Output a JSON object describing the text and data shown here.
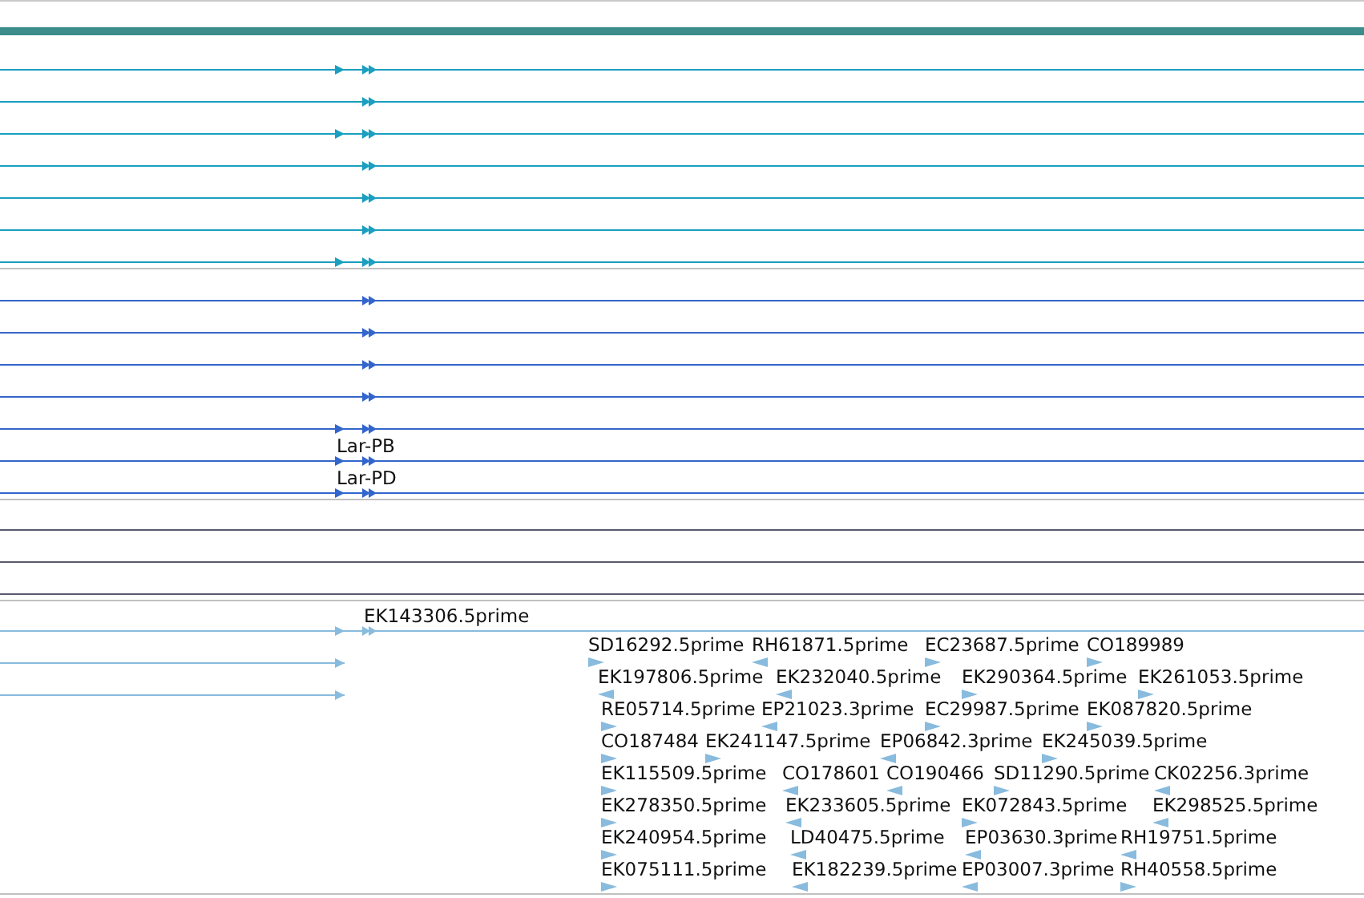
{
  "tracks": [
    {
      "color": "#1a9fc0",
      "rows": [
        {
          "upstream_arrow": true,
          "double_arrow": true,
          "truncated": false
        },
        {
          "upstream_arrow": false,
          "double_arrow": true,
          "truncated": false
        },
        {
          "upstream_arrow": true,
          "double_arrow": true,
          "truncated": false
        },
        {
          "upstream_arrow": false,
          "double_arrow": true,
          "truncated": false
        },
        {
          "upstream_arrow": false,
          "double_arrow": true,
          "truncated": false
        },
        {
          "upstream_arrow": false,
          "double_arrow": true,
          "truncated": false
        },
        {
          "upstream_arrow": true,
          "double_arrow": true,
          "truncated": false
        }
      ]
    },
    {
      "color": "#3366cc",
      "rows": [
        {
          "upstream_arrow": false,
          "double_arrow": true,
          "truncated": false
        },
        {
          "upstream_arrow": false,
          "double_arrow": true,
          "truncated": false
        },
        {
          "upstream_arrow": false,
          "double_arrow": true,
          "truncated": false
        },
        {
          "upstream_arrow": false,
          "double_arrow": true,
          "truncated": false
        },
        {
          "upstream_arrow": true,
          "double_arrow": true,
          "truncated": false
        },
        {
          "upstream_arrow": true,
          "double_arrow": true,
          "truncated": false,
          "label": "Lar-PB"
        },
        {
          "upstream_arrow": true,
          "double_arrow": true,
          "truncated": false,
          "label": "Lar-PD"
        }
      ]
    },
    {
      "color": "#5a5a6e",
      "rows": [
        {
          "upstream_arrow": false,
          "double_arrow": false,
          "truncated": false
        },
        {
          "upstream_arrow": false,
          "double_arrow": false,
          "truncated": false
        },
        {
          "upstream_arrow": false,
          "double_arrow": false,
          "truncated": false
        }
      ]
    },
    {
      "color": "#88bbdd",
      "rows": [
        {
          "upstream_arrow": true,
          "double_arrow": true,
          "truncated": false,
          "label": "EK143306.5prime"
        },
        {
          "upstream_arrow": true,
          "double_arrow": false,
          "truncated": true
        },
        {
          "upstream_arrow": true,
          "double_arrow": false,
          "truncated": true
        }
      ],
      "reads": [
        [
          {
            "label": "SD16292.5prime",
            "reverse": false
          },
          {
            "label": "RH61871.5prime",
            "reverse": true
          },
          {
            "label": "EC23687.5prime",
            "reverse": false
          },
          {
            "label": "CO189989",
            "reverse": false
          }
        ],
        [
          {
            "label": "EK197806.5prime",
            "reverse": true
          },
          {
            "label": "EK232040.5prime",
            "reverse": true
          },
          {
            "label": "EK290364.5prime",
            "reverse": false
          },
          {
            "label": "EK261053.5prime",
            "reverse": false
          }
        ],
        [
          {
            "label": "RE05714.5prime",
            "reverse": false
          },
          {
            "label": "EP21023.3prime",
            "reverse": true
          },
          {
            "label": "EC29987.5prime",
            "reverse": false
          },
          {
            "label": "EK087820.5prime",
            "reverse": false
          }
        ],
        [
          {
            "label": "CO187484",
            "reverse": false
          },
          {
            "label": "EK241147.5prime",
            "reverse": false
          },
          {
            "label": "EP06842.3prime",
            "reverse": true
          },
          {
            "label": "EK245039.5prime",
            "reverse": false
          }
        ],
        [
          {
            "label": "EK115509.5prime",
            "reverse": false
          },
          {
            "label": "CO178601",
            "reverse": true
          },
          {
            "label": "CO190466",
            "reverse": true
          },
          {
            "label": "SD11290.5prime",
            "reverse": false
          },
          {
            "label": "CK02256.3prime",
            "reverse": true
          }
        ],
        [
          {
            "label": "EK278350.5prime",
            "reverse": false
          },
          {
            "label": "EK233605.5prime",
            "reverse": true
          },
          {
            "label": "EK072843.5prime",
            "reverse": false
          },
          {
            "label": "EK298525.5prime",
            "reverse": true
          }
        ],
        [
          {
            "label": "EK240954.5prime",
            "reverse": false
          },
          {
            "label": "LD40475.5prime",
            "reverse": true
          },
          {
            "label": "EP03630.3prime",
            "reverse": true
          },
          {
            "label": "RH19751.5prime",
            "reverse": true
          }
        ],
        [
          {
            "label": "EK075111.5prime",
            "reverse": false
          },
          {
            "label": "EK182239.5prime",
            "reverse": true
          },
          {
            "label": "EP03007.3prime",
            "reverse": true
          },
          {
            "label": "RH40558.5prime",
            "reverse": false
          }
        ]
      ]
    }
  ]
}
